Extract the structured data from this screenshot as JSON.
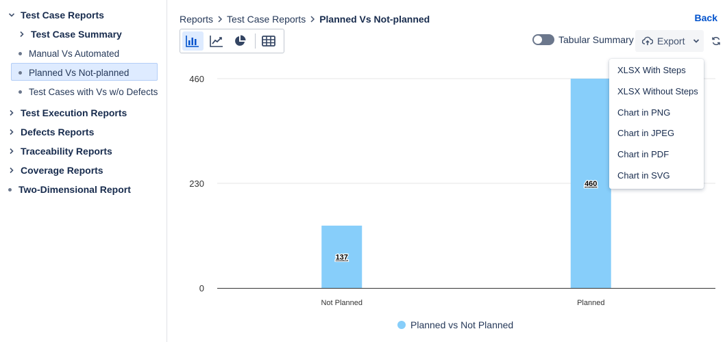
{
  "sidebar": {
    "items": [
      {
        "label": "Test Case Reports",
        "style": "bold",
        "marker": "chevron-down"
      },
      {
        "label": "Test Case Summary",
        "style": "bold",
        "marker": "chevron-right"
      },
      {
        "label": "Manual Vs Automated",
        "style": "normal",
        "marker": "dot"
      },
      {
        "label": "Planned Vs Not-planned",
        "style": "normal",
        "marker": "dot",
        "selected": true
      },
      {
        "label": "Test Cases with Vs w/o Defects",
        "style": "normal",
        "marker": "dot"
      },
      {
        "label": "Test Execution Reports",
        "style": "bold",
        "marker": "chevron-right"
      },
      {
        "label": "Defects Reports",
        "style": "bold",
        "marker": "chevron-right"
      },
      {
        "label": "Traceability Reports",
        "style": "bold",
        "marker": "chevron-right"
      },
      {
        "label": "Coverage Reports",
        "style": "bold",
        "marker": "chevron-right"
      },
      {
        "label": "Two-Dimensional Report",
        "style": "bold",
        "marker": "dot"
      }
    ]
  },
  "header": {
    "breadcrumb": [
      "Reports",
      "Test Case Reports",
      "Planned Vs Not-planned"
    ],
    "back_label": "Back"
  },
  "toolbar": {
    "views": [
      {
        "name": "bar-chart-icon",
        "active": true
      },
      {
        "name": "line-chart-icon",
        "active": false
      },
      {
        "name": "pie-chart-icon",
        "active": false
      },
      {
        "name": "table-icon",
        "active": false
      }
    ],
    "tabular_summary_label": "Tabular Summary",
    "tabular_summary_on": false,
    "export_label": "Export"
  },
  "export_menu": {
    "items": [
      "XLSX With Steps",
      "XLSX Without Steps",
      "Chart in PNG",
      "Chart in JPEG",
      "Chart in PDF",
      "Chart in SVG"
    ]
  },
  "colors": {
    "bar": "#87cefa",
    "accent": "#0052cc",
    "selected_bg": "#deebff"
  },
  "chart_data": {
    "type": "bar",
    "categories": [
      "Not Planned",
      "Planned"
    ],
    "series": [
      {
        "name": "Planned vs Not Planned",
        "values": [
          137,
          460
        ]
      }
    ],
    "y_ticks": [
      0,
      230,
      460
    ],
    "ylim": [
      0,
      460
    ],
    "data_labels": [
      "137",
      "460"
    ],
    "grid": true,
    "legend": "bottom-center"
  }
}
